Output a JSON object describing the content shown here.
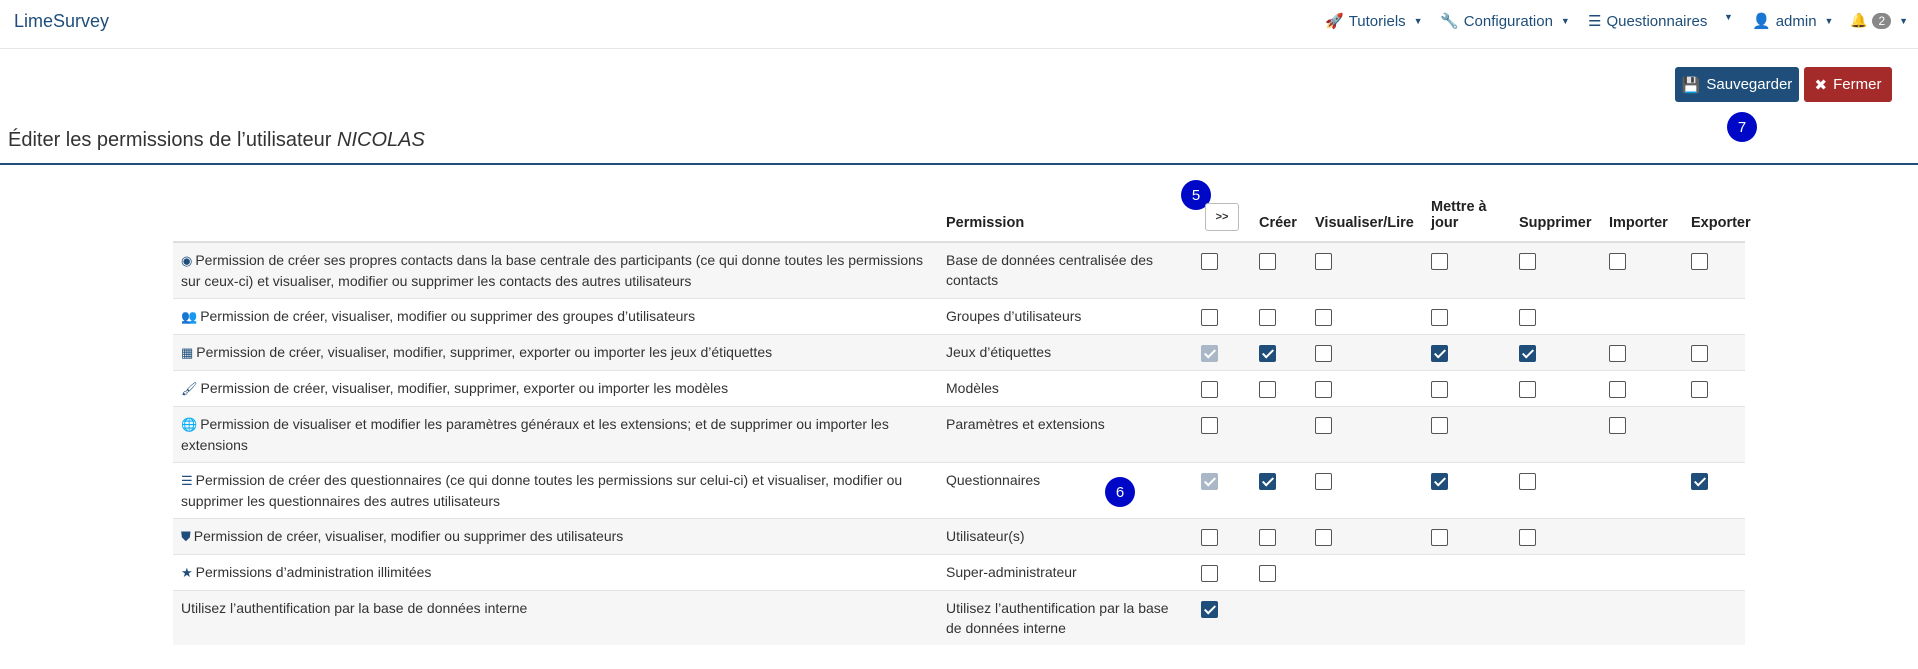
{
  "nav": {
    "brand": "LimeSurvey",
    "tutorials": "Tutoriels",
    "configuration": "Configuration",
    "surveys": "Questionnaires",
    "user": "admin",
    "notifications_count": "2"
  },
  "toolbar": {
    "save_label": "Sauvegarder",
    "close_label": "Fermer"
  },
  "markers": {
    "m5": "5",
    "m6": "6",
    "m7": "7"
  },
  "page": {
    "title_prefix": "Éditer les permissions de l’utilisateur",
    "username": "NICOLAS"
  },
  "table": {
    "headers": {
      "permission": "Permission",
      "toggle": ">>",
      "create": "Créer",
      "read": "Visualiser/Lire",
      "update": "Mettre à jour",
      "delete": "Supprimer",
      "import": "Importer",
      "export": "Exporter"
    },
    "rows": [
      {
        "desc": "Permission de créer ses propres contacts dans la base centrale des participants (ce qui donne toutes les permissions sur ceux-ci) et visualiser, modifier ou supprimer les contacts des autres utilisateurs",
        "name": "Base de données centralisée des contacts",
        "icon": "user-circle-icon"
      },
      {
        "desc": "Permission de créer, visualiser, modifier ou supprimer des groupes d’utilisateurs",
        "name": "Groupes d’utilisateurs",
        "icon": "users-icon"
      },
      {
        "desc": "Permission de créer, visualiser, modifier, supprimer, exporter ou importer les jeux d’étiquettes",
        "name": "Jeux d’étiquettes",
        "icon": "th-list-icon"
      },
      {
        "desc": "Permission de créer, visualiser, modifier, supprimer, exporter ou importer les modèles",
        "name": "Modèles",
        "icon": "paint-brush-icon"
      },
      {
        "desc": "Permission de visualiser et modifier les paramètres généraux et les extensions; et de supprimer ou importer les extensions",
        "name": "Paramètres et extensions",
        "icon": "globe-icon"
      },
      {
        "desc": "Permission de créer des questionnaires (ce qui donne toutes les permissions sur celui-ci) et visualiser, modifier ou supprimer les questionnaires des autres utilisateurs",
        "name": "Questionnaires",
        "icon": "list-icon"
      },
      {
        "desc": "Permission de créer, visualiser, modifier ou supprimer des utilisateurs",
        "name": "Utilisateur(s)",
        "icon": "shield-icon"
      },
      {
        "desc": "Permissions d’administration illimitées",
        "name": "Super-administrateur",
        "icon": "star-icon"
      },
      {
        "desc": "Utilisez l’authentification par la base de données interne",
        "name": "Utilisez l’authentification par la base de données interne",
        "icon": ""
      }
    ]
  },
  "colors": {
    "primary": "#1e4e79",
    "danger": "#a52a2a",
    "marker": "#0008c8"
  }
}
